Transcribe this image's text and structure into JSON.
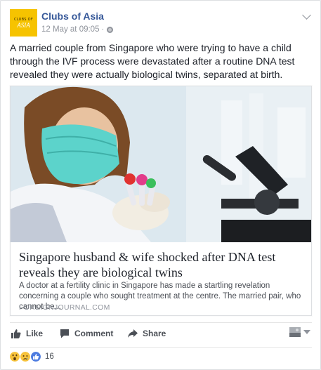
{
  "post": {
    "page_name": "Clubs of Asia",
    "logo_top": "CLUBS OF",
    "logo_bottom": "ASIA",
    "timestamp": "12 May at 09:05",
    "separator": "·",
    "text": "A married couple from Singapore who were trying to have a child through the IVF process were devastated after a routine DNA test revealed they were actually biological twins, separated at birth."
  },
  "link": {
    "title": "Singapore husband & wife shocked after DNA test reveals they are biological twins",
    "description": "A doctor at a fertility clinic in Singapore has made a startling revelation concerning a couple who sought treatment at the centre. The married pair, who cannot be...",
    "domain": "FOREIGNJOURNAL.COM"
  },
  "actions": {
    "like": "Like",
    "comment": "Comment",
    "share": "Share"
  },
  "reactions": {
    "count": "16",
    "types": [
      "wow-icon",
      "sad-icon",
      "like-icon"
    ]
  },
  "colors": {
    "link_blue": "#365899",
    "meta_gray": "#90949c",
    "logo_yellow": "#f6c300"
  }
}
